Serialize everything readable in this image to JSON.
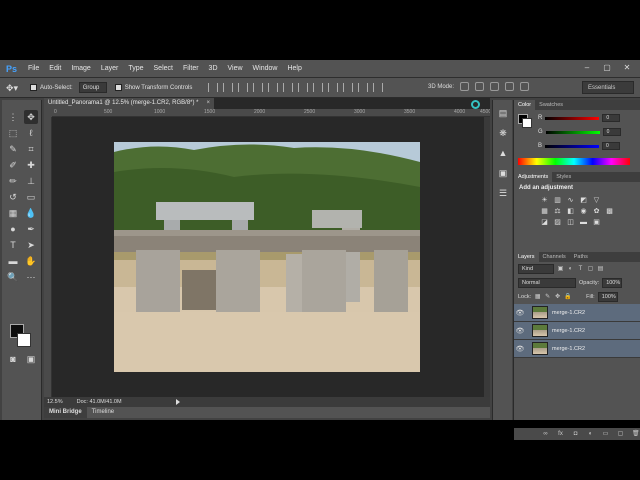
{
  "app": {
    "logo": "Ps"
  },
  "menu": {
    "items": [
      "File",
      "Edit",
      "Image",
      "Layer",
      "Type",
      "Select",
      "Filter",
      "3D",
      "View",
      "Window",
      "Help"
    ]
  },
  "window_controls": {
    "minimize": "–",
    "restore": "▢",
    "close": "✕"
  },
  "options_bar": {
    "tool_icon": "move-tool-icon",
    "auto_select_label": "Auto-Select:",
    "auto_select_value": "Group",
    "transform_label": "Show Transform Controls",
    "mode_label": "3D Mode:",
    "workspace": "Essentials"
  },
  "document": {
    "tab_title": "Untitled_Panorama1 @ 12.5% (merge-1.CR2, RGB/8*) *",
    "tab_close": "×",
    "ruler_labels": [
      "0",
      "500",
      "1000",
      "1500",
      "2000",
      "2500",
      "3000",
      "3500",
      "4000",
      "4500"
    ]
  },
  "status": {
    "zoom": "12.5%",
    "doc": "Doc: 41.0M/41.0M"
  },
  "bottom_tabs": [
    "Mini Bridge",
    "Timeline"
  ],
  "color_panel": {
    "tabs": [
      "Color",
      "Swatches"
    ],
    "channels": [
      {
        "label": "R",
        "value": "0"
      },
      {
        "label": "G",
        "value": "0"
      },
      {
        "label": "B",
        "value": "0"
      }
    ]
  },
  "adjustments_panel": {
    "tabs": [
      "Adjustments",
      "Styles"
    ],
    "title": "Add an adjustment"
  },
  "layers_panel": {
    "tabs": [
      "Layers",
      "Channels",
      "Paths"
    ],
    "filter_kind": "Kind",
    "blend_mode": "Normal",
    "opacity_label": "Opacity:",
    "opacity": "100%",
    "lock_label": "Lock:",
    "fill_label": "Fill:",
    "fill": "100%",
    "layers": [
      {
        "name": "merge-1.CR2"
      },
      {
        "name": "merge-1.CR2"
      },
      {
        "name": "merge-1.CR2"
      }
    ]
  },
  "colors": {
    "accent": "#35c1c1",
    "ps_blue": "#46a3ff",
    "selected_layer": "#5d6b7d"
  }
}
